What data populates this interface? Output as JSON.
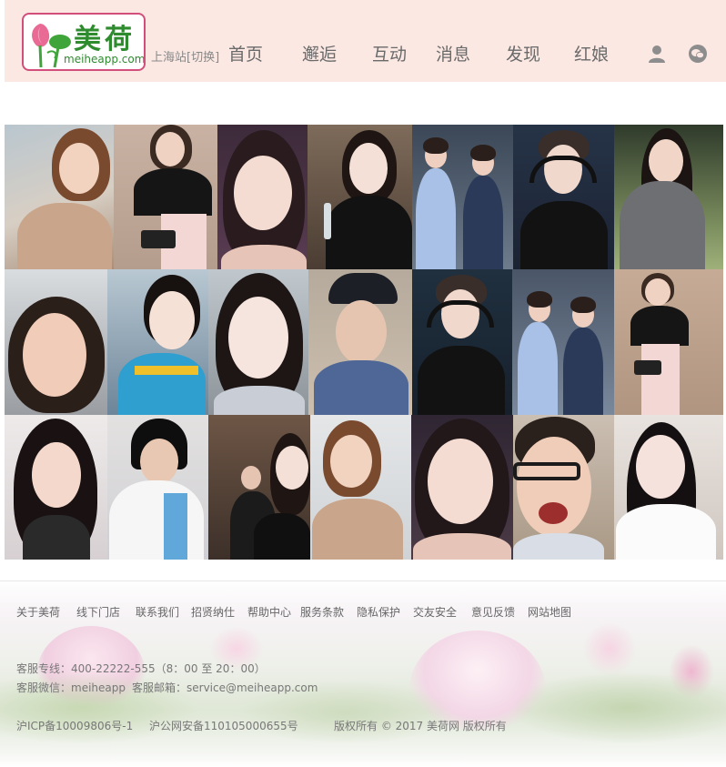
{
  "header": {
    "logo": {
      "cn": "美荷",
      "url": "meiheapp.com"
    },
    "city": "上海站[切换]",
    "nav": [
      {
        "label": "首页"
      },
      {
        "label": "邂逅"
      },
      {
        "label": "互动"
      },
      {
        "label": "消息"
      },
      {
        "label": "发现"
      },
      {
        "label": "红娘"
      }
    ],
    "icons": [
      "user-icon",
      "chat-icon"
    ],
    "background": "#fbe8e3"
  },
  "gallery": {
    "rows": 3,
    "photos": [
      "profile-photo",
      "profile-photo",
      "profile-photo",
      "profile-photo",
      "profile-photo",
      "profile-photo",
      "profile-photo",
      "profile-photo",
      "profile-photo",
      "profile-photo",
      "profile-photo",
      "profile-photo",
      "profile-photo",
      "profile-photo",
      "profile-photo",
      "profile-photo",
      "profile-photo",
      "profile-photo",
      "profile-photo",
      "profile-photo",
      "profile-photo"
    ]
  },
  "footer": {
    "links": [
      "关于美荷",
      "线下门店",
      "联系我们",
      "招贤纳仕",
      "帮助中心",
      "服务条款",
      "隐私保护",
      "交友安全",
      "意见反馈",
      "网站地图"
    ],
    "hotline": "客服专线：400-22222-555（8：00 至 20：00）",
    "wechat": "客服微信：meiheapp",
    "email": "客服邮箱：service@meiheapp.com",
    "icp": "沪ICP备10009806号-1",
    "police": "沪公网安备110105000655号",
    "copyright": "版权所有 © 2017 美荷网 版权所有"
  },
  "colors": {
    "brand_green": "#2e8b2e",
    "brand_pink": "#d14f7a",
    "nav_text": "#6a6a6a"
  }
}
